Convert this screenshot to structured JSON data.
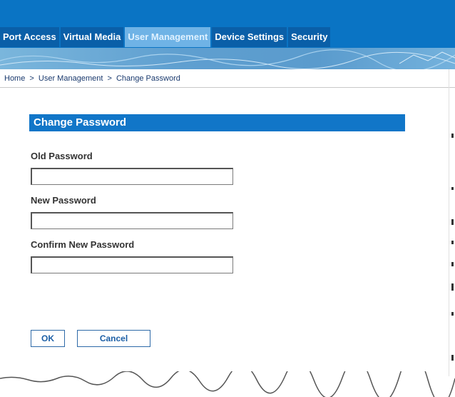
{
  "tabs": [
    {
      "label": "Port Access",
      "active": false
    },
    {
      "label": "Virtual Media",
      "active": false
    },
    {
      "label": "User Management",
      "active": true
    },
    {
      "label": "Device Settings",
      "active": false
    },
    {
      "label": "Security",
      "active": false
    }
  ],
  "breadcrumb": {
    "home": "Home",
    "separator": ">",
    "section": "User Management",
    "current": "Change Password"
  },
  "panel": {
    "title": "Change Password"
  },
  "fields": {
    "old_password": {
      "label": "Old Password",
      "value": ""
    },
    "new_password": {
      "label": "New Password",
      "value": ""
    },
    "confirm_password": {
      "label": "Confirm New Password",
      "value": ""
    }
  },
  "buttons": {
    "ok": "OK",
    "cancel": "Cancel"
  },
  "colors": {
    "header_blue": "#0a74c4",
    "active_tab": "#6fb3e6",
    "panel_title_bg": "#1176c8",
    "button_text": "#1c5fa6"
  }
}
